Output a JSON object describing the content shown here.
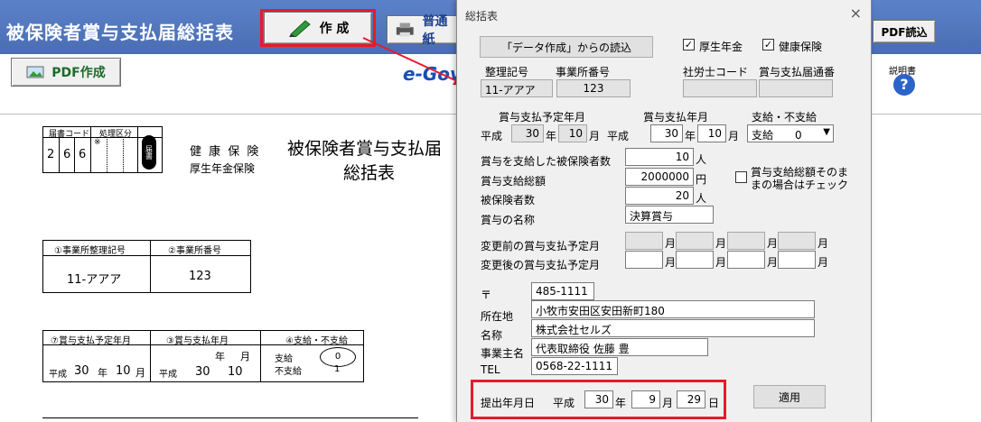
{
  "app": {
    "title": "被保険者賞与支払届総括表",
    "btn_create": "作 成",
    "btn_normal": "普通紙",
    "btn_pdf_read": "PDF読込",
    "btn_pdf_create": "PDF作成",
    "egov": "e-Gov",
    "help": "説明書"
  },
  "sheet": {
    "code_header": "届書コード",
    "proc_header": "処理区分",
    "code_digits": [
      "2",
      "6",
      "6"
    ],
    "asterisk": "※",
    "stamp": "届書",
    "insurance1": "健 康 保 険",
    "insurance2": "厚生年金保険",
    "title1": "被保険者賞与支払届",
    "title2": "総括表",
    "h_office_code": "①事業所整理記号",
    "h_office_no": "②事業所番号",
    "v_office_code": "11-アアア",
    "v_office_no": "123",
    "h_plan": "⑦賞与支払予定年月",
    "h_paid": "③賞与支払年月",
    "h_pay": "④支給・不支給",
    "era": "平成",
    "plan_year": "30",
    "year_u": "年",
    "plan_month": "10",
    "month_u": "月",
    "paid_year": "30",
    "paid_month": "10",
    "pay_opt1": "支給",
    "pay_opt2": "不支給",
    "pay_v0": "0",
    "pay_v1": "1"
  },
  "dialog": {
    "title": "総括表",
    "close": "×",
    "load_button": "「データ作成」からの読込",
    "chk_pension_label": "厚生年金",
    "chk_health_label": "健康保険",
    "check_mark": "✓",
    "lbl_office_code": "整理記号",
    "lbl_office_no": "事業所番号",
    "val_office_code": "11-アアア",
    "val_office_no": "123",
    "lbl_sharoushi": "社労士コード",
    "lbl_notif_no": "賞与支払届通番",
    "lbl_plan_ym": "賞与支払予定年月",
    "lbl_paid_ym": "賞与支払年月",
    "lbl_pay": "支給・不支給",
    "era": "平成",
    "year_u": "年",
    "month_u": "月",
    "day_u": "日",
    "plan_year": "30",
    "plan_month": "10",
    "paid_year": "30",
    "paid_month": "10",
    "pay_select": "支給　　0",
    "lbl_count_paid": "賞与を支給した被保険者数",
    "val_count_paid": "10",
    "unit_person": "人",
    "lbl_total": "賞与支給総額",
    "val_total": "2000000",
    "unit_yen": "円",
    "lbl_insured": "被保険者数",
    "val_insured": "20",
    "lbl_bonus_name": "賞与の名称",
    "val_bonus_name": "決算賞与",
    "chk_keep_label1": "賞与支給総額そのま",
    "chk_keep_label2": "まの場合はチェック",
    "lbl_before": "変更前の賞与支払予定月",
    "lbl_after": "変更後の賞与支払予定月",
    "zip_mark": "〒",
    "val_zip": "485-1111",
    "lbl_address": "所在地",
    "val_address": "小牧市安田区安田新町180",
    "lbl_name": "名称",
    "val_name": "株式会社セルズ",
    "lbl_owner": "事業主名",
    "val_owner": "代表取締役  佐藤  豊",
    "lbl_tel": "TEL",
    "val_tel": "0568-22-1111",
    "lbl_submit": "提出年月日",
    "submit_year": "30",
    "submit_month": "9",
    "submit_day": "29",
    "apply_button": "適用"
  },
  "colors": {
    "titlebar": "#4f74bd",
    "highlight": "#e8192c",
    "dialog_bg": "#f0f0f0"
  }
}
